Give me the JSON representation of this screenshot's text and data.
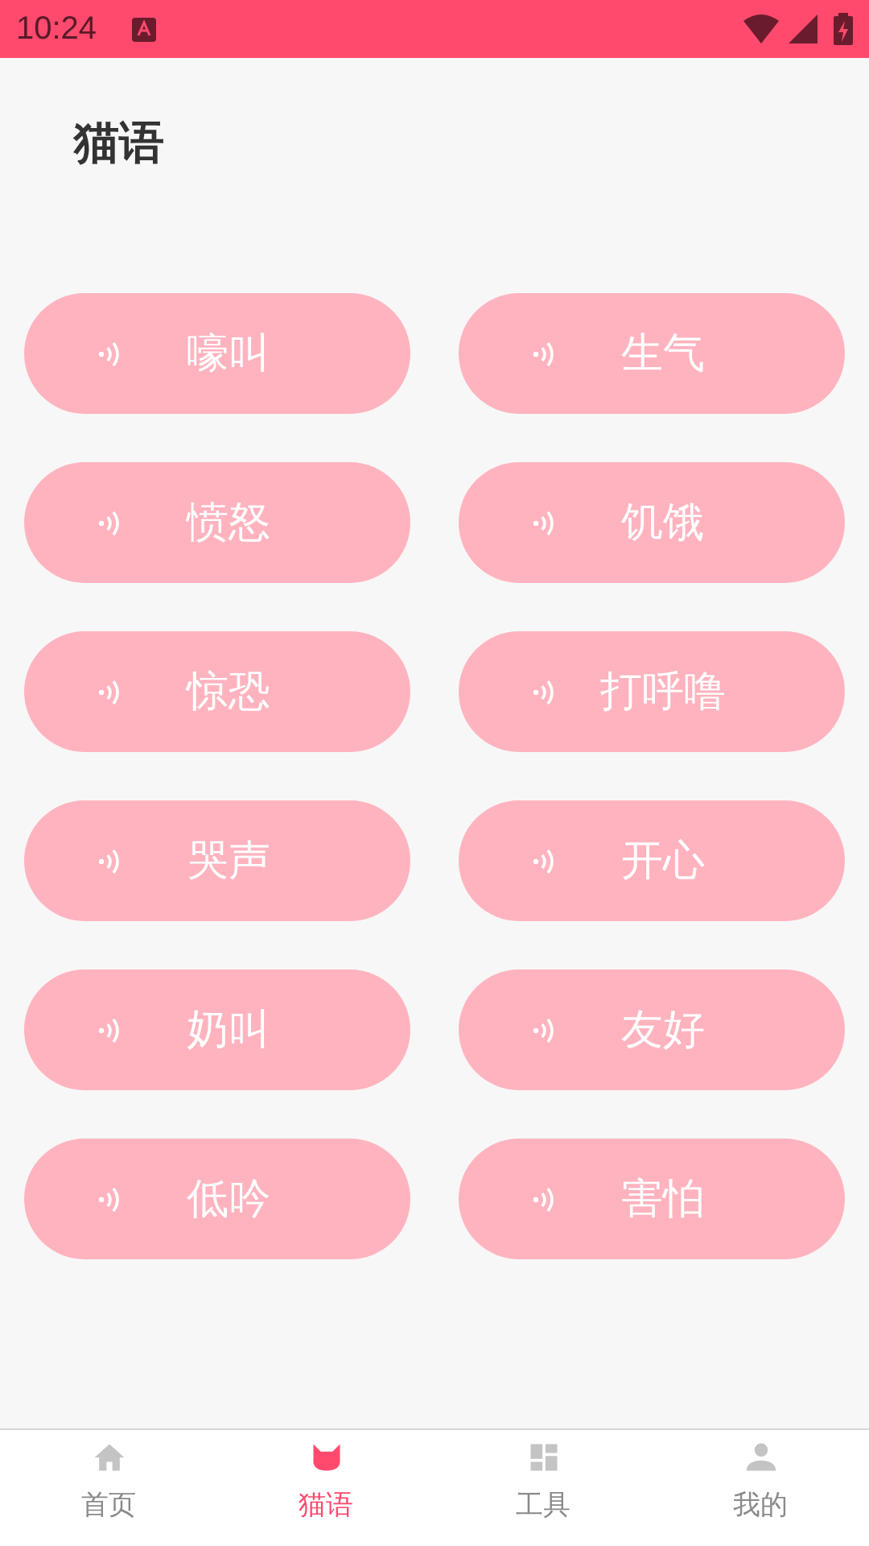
{
  "status_bar": {
    "time": "10:24"
  },
  "title": "猫语",
  "sounds": [
    {
      "label": "嚎叫"
    },
    {
      "label": "生气"
    },
    {
      "label": "愤怒"
    },
    {
      "label": "饥饿"
    },
    {
      "label": "惊恐"
    },
    {
      "label": "打呼噜"
    },
    {
      "label": "哭声"
    },
    {
      "label": "开心"
    },
    {
      "label": "奶叫"
    },
    {
      "label": "友好"
    },
    {
      "label": "低吟"
    },
    {
      "label": "害怕"
    }
  ],
  "nav": [
    {
      "label": "首页",
      "selected": false
    },
    {
      "label": "猫语",
      "selected": true
    },
    {
      "label": "工具",
      "selected": false
    },
    {
      "label": "我的",
      "selected": false
    }
  ]
}
